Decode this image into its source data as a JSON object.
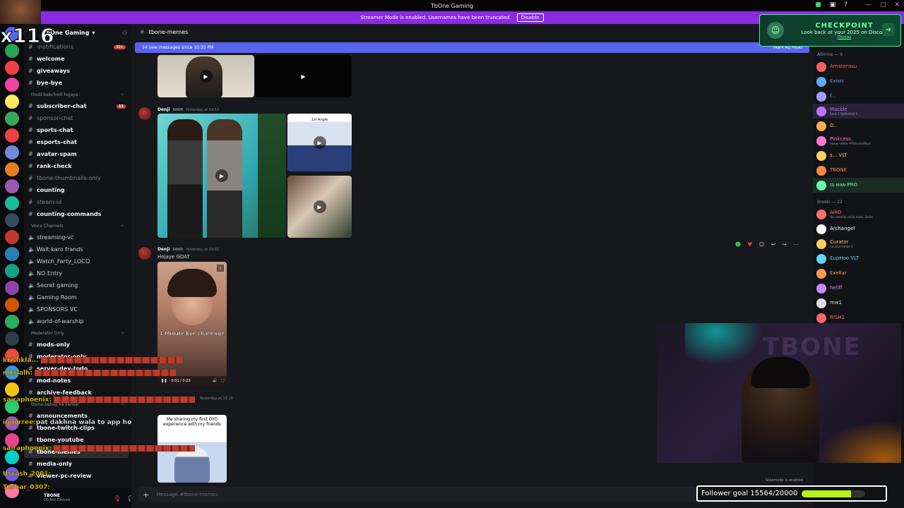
{
  "window": {
    "title": "TbOne Gaming"
  },
  "banner": {
    "text": "Streamer Mode is enabled. Usernames have been truncated.",
    "button": "Disable"
  },
  "server": {
    "name": "TbOne Gaming"
  },
  "sidebar": {
    "top_channels": [
      {
        "label": "-notifications",
        "style": "dim",
        "count": "99+"
      },
      {
        "label": "welcome",
        "style": "bright"
      },
      {
        "label": "giveaways",
        "style": "bright"
      },
      {
        "label": "bye-bye",
        "style": "bright"
      }
    ],
    "cat1": "thodi bakchodi hojaye",
    "text_channels": [
      {
        "label": "subscriber-chat",
        "style": "bright",
        "count": "11"
      },
      {
        "label": "sponsor-chat",
        "style": "dim"
      },
      {
        "label": "sports-chat",
        "style": "bright"
      },
      {
        "label": "esports-chat",
        "style": "bright"
      },
      {
        "label": "avatar-spam",
        "style": "bright"
      },
      {
        "label": "rank-check",
        "style": "bright"
      },
      {
        "label": "tbone-thumbnails-only",
        "style": "dim"
      },
      {
        "label": "counting",
        "style": "bright"
      },
      {
        "label": "steam-id",
        "style": "dim"
      },
      {
        "label": "counting-commands",
        "style": "bright"
      }
    ],
    "cat2": "Voice Channels",
    "voice_channels": [
      "streaming-vc",
      "Wait karo frands",
      "Watch_Farty_LOCO",
      "NO Entry",
      "Secret gaming",
      "Gaming Room",
      "SPONSORS VC",
      "world-of-warship"
    ],
    "cat3": "Moderator Only",
    "mod_channels": [
      "mods-only",
      "moderator-only",
      "server-dev-todo",
      "mod-notes",
      "archive-feedback"
    ],
    "cat4": "tbone babaji ka sansar",
    "bottom_channels": [
      "announcements",
      "tbone-twitch-clips",
      "tbone-youtube",
      "tbone-memes",
      "media-only",
      "viewer-pc-review"
    ],
    "active": "tbone-memes"
  },
  "user_panel": {
    "name": "TBONE",
    "status": "Do Not Disturb"
  },
  "main": {
    "channel": "tbone-memes",
    "new_messages": "14 new messages since 10:35 PM",
    "mark_read": "Mark As Read",
    "msg1": {
      "author": "Denji",
      "tag": "RAWR",
      "time": "Yesterday at 14:53"
    },
    "msg2": {
      "author": "Denji",
      "tag": "RAWR",
      "time": "Yesterday at 15:01",
      "text": "Hojaye GOAT",
      "video_caption": "1 Minute Eye challenge",
      "video_time": "0:01 / 0:23"
    },
    "msg3": {
      "time": "Yesterday at 15:16",
      "caption": "Me sharing my first OYO experience with my friends"
    },
    "thumb_label": "1st Angle",
    "composer_placeholder": "Message #tbone-memes",
    "slowmode": "Slowmode is enabled"
  },
  "members": {
    "group1": "Admins — 9",
    "admins": [
      {
        "name": "Amaterasu",
        "color": "#ff5f5f"
      },
      {
        "name": "Exion",
        "color": "#5fa8ff"
      },
      {
        "name": "f...",
        "color": "#a0a0ff"
      },
      {
        "name": "Mackle",
        "status": "Rank 1 Battlefield II...",
        "color": "#c070ff"
      },
      {
        "name": "O...",
        "color": "#ffaa55"
      },
      {
        "name": "Pinkcess",
        "status": "heavy roblox #PinkcessPlays",
        "color": "#ff77cc"
      },
      {
        "name": "s... VLT",
        "color": "#ffd060"
      },
      {
        "name": "TBONE",
        "color": "#ff8844"
      },
      {
        "name": "ɪꜱ ᴍᴀɴ PRO",
        "color": "#66ffaa"
      }
    ],
    "group2": "Broski — 22",
    "broski": [
      {
        "name": "AIKO",
        "status": "You need to smile more. Smile",
        "color": "#ff7070"
      },
      {
        "name": "Archangel",
        "color": "#ffffff"
      },
      {
        "name": "Curator",
        "status": "Counter-Strike 2",
        "color": "#ffd060"
      },
      {
        "name": "EupHoo VLT",
        "color": "#5fd6ff"
      },
      {
        "name": "Exellar",
        "color": "#ff9955"
      },
      {
        "name": "hellff",
        "color": "#cc88ff"
      },
      {
        "name": "mw1",
        "color": "#dddddd"
      },
      {
        "name": "RISH1",
        "color": "#ff6666"
      }
    ]
  },
  "checkpoint": {
    "title": "CHECKPOINT",
    "subtitle": "Look back at your 2025 on Discord",
    "link": "Dismiss"
  },
  "overlay": {
    "combo": "x116",
    "follower_goal": "Follower goal 15564/20000",
    "follower_progress": 0.7782,
    "webcam_watermark": "TBONE",
    "chat": [
      {
        "user": "krishkla...",
        "text": ""
      },
      {
        "user": "mkrlalh:",
        "text": ""
      },
      {
        "user": "",
        "text": ""
      },
      {
        "user": "sairaphoenix:",
        "text": ""
      },
      {
        "user": "ignorree:",
        "text": "pat dakhna wala to app ho"
      },
      {
        "user": "sairaphoenix:",
        "text": ""
      },
      {
        "user": "Usrash_2001:",
        "text": ""
      },
      {
        "user": "Tushar_0307:",
        "text": ""
      }
    ]
  }
}
